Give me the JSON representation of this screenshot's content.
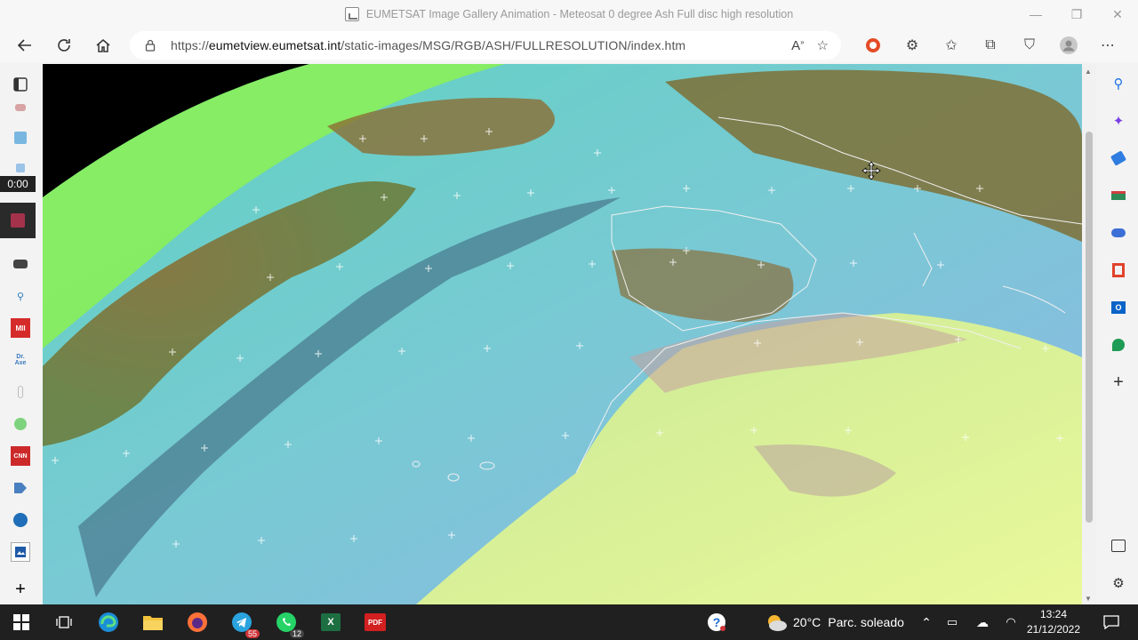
{
  "window": {
    "title": "EUMETSAT Image Gallery Animation - Meteosat 0 degree Ash Full disc high resolution",
    "controls": [
      "—",
      "❐",
      "✕"
    ]
  },
  "address_bar": {
    "url_prefix": "https://",
    "url_host": "eumetview.eumetsat.int",
    "url_path": "/static-images/MSG/RGB/ASH/FULLRESOLUTION/index.htm"
  },
  "recorder": {
    "timer": "0:00"
  },
  "left_sidebar": {
    "items": [
      "MII",
      "Dr.\nAxe",
      "CNN"
    ]
  },
  "taskbar": {
    "apps": [
      {
        "name": "telegram",
        "badge": "55"
      },
      {
        "name": "whatsapp",
        "badge": "12"
      },
      {
        "name": "pdf",
        "label": "PDF"
      },
      {
        "name": "excel",
        "label": "X"
      }
    ],
    "weather": {
      "temp": "20°C",
      "condition": "Parc. soleado"
    },
    "clock": {
      "time": "13:24",
      "date": "21/12/2022"
    }
  },
  "colors": {
    "accent_blue": "#0a66c2",
    "pdf_red": "#d21f1f",
    "excel_green": "#1d6f42",
    "whatsapp_green": "#25d366",
    "telegram_blue": "#2aa3df"
  }
}
